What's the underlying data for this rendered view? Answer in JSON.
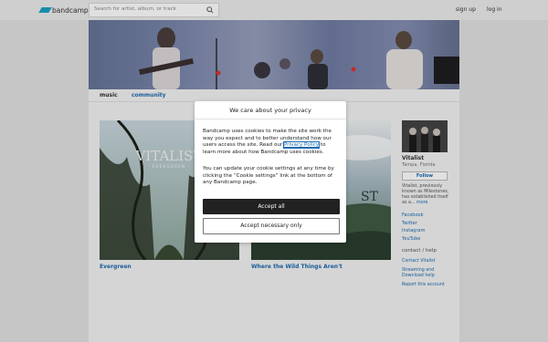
{
  "header": {
    "logo_text": "bandcamp",
    "search_placeholder": "Search for artist, album, or track",
    "signup": "sign up",
    "login": "log in"
  },
  "nav": {
    "music": "music",
    "community": "community"
  },
  "albums": [
    {
      "title": "Evergreen",
      "cover_text": "VITALIST",
      "cover_sub": "EVERGREEN"
    },
    {
      "title": "Where the Wild Things Aren't",
      "cover_text": "ST"
    }
  ],
  "artist": {
    "name": "Vitalist",
    "location": "Tampa, Florida",
    "follow": "Follow",
    "bio": "Vitalist, previously known as Milestones, has established itself as a...",
    "more": "more",
    "links": [
      "Facebook",
      "Twitter",
      "Instagram",
      "YouTube"
    ],
    "contact_label": "contact / help",
    "contact_link": "Contact Vitalist",
    "streaming_help": "Streaming and Download help",
    "report": "Report this account"
  },
  "cookie_modal": {
    "title": "We care about your privacy",
    "para1_a": "Bandcamp uses cookies to make the site work the way you expect and to better understand how our users access the site. Read our ",
    "privacy_link": "Privacy Policy",
    "para1_b": " to learn more about how Bandcamp uses cookies.",
    "para2": "You can update your cookie settings at any time by clicking the “Cookie settings” link at the bottom of any Bandcamp page.",
    "accept_all": "Accept all",
    "accept_necessary": "Accept necessary only"
  },
  "colors": {
    "accent": "#1da0c3",
    "link": "#1c6ab0"
  }
}
